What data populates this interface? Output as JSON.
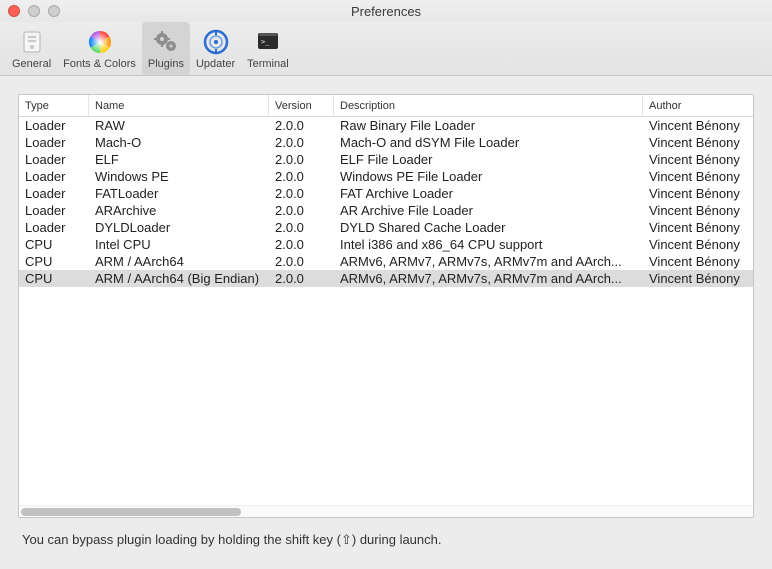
{
  "window": {
    "title": "Preferences"
  },
  "toolbar": {
    "items": [
      {
        "id": "general",
        "label": "General"
      },
      {
        "id": "fonts",
        "label": "Fonts & Colors"
      },
      {
        "id": "plugins",
        "label": "Plugins"
      },
      {
        "id": "updater",
        "label": "Updater"
      },
      {
        "id": "terminal",
        "label": "Terminal"
      }
    ],
    "selected": "plugins"
  },
  "table": {
    "headers": {
      "type": "Type",
      "name": "Name",
      "version": "Version",
      "description": "Description",
      "author": "Author"
    },
    "rows": [
      {
        "type": "Loader",
        "name": "RAW",
        "version": "2.0.0",
        "description": "Raw Binary File Loader",
        "author": "Vincent Bénony"
      },
      {
        "type": "Loader",
        "name": "Mach-O",
        "version": "2.0.0",
        "description": "Mach-O and dSYM File Loader",
        "author": "Vincent Bénony"
      },
      {
        "type": "Loader",
        "name": "ELF",
        "version": "2.0.0",
        "description": "ELF File Loader",
        "author": "Vincent Bénony"
      },
      {
        "type": "Loader",
        "name": "Windows PE",
        "version": "2.0.0",
        "description": "Windows PE File Loader",
        "author": "Vincent Bénony"
      },
      {
        "type": "Loader",
        "name": "FATLoader",
        "version": "2.0.0",
        "description": "FAT Archive Loader",
        "author": "Vincent Bénony"
      },
      {
        "type": "Loader",
        "name": "ARArchive",
        "version": "2.0.0",
        "description": "AR Archive File Loader",
        "author": "Vincent Bénony"
      },
      {
        "type": "Loader",
        "name": "DYLDLoader",
        "version": "2.0.0",
        "description": "DYLD Shared Cache Loader",
        "author": "Vincent Bénony"
      },
      {
        "type": "CPU",
        "name": "Intel CPU",
        "version": "2.0.0",
        "description": "Intel i386 and x86_64 CPU support",
        "author": "Vincent Bénony"
      },
      {
        "type": "CPU",
        "name": "ARM / AArch64",
        "version": "2.0.0",
        "description": "ARMv6, ARMv7, ARMv7s, ARMv7m and AArch...",
        "author": "Vincent Bénony"
      },
      {
        "type": "CPU",
        "name": "ARM / AArch64 (Big Endian)",
        "version": "2.0.0",
        "description": "ARMv6, ARMv7, ARMv7s, ARMv7m and AArch...",
        "author": "Vincent Bénony"
      }
    ],
    "selected_index": 9
  },
  "hint": {
    "prefix": "You can bypass plugin loading by holding the shift key (",
    "symbol": "⇧",
    "suffix": ") during launch."
  }
}
